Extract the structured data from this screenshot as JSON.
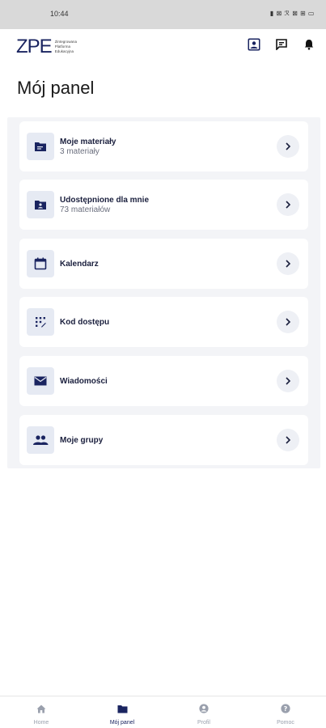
{
  "status_bar": {
    "time": "10:44",
    "indicators": "▮ ⊠ ℛ ⊠ ⊞ ▭"
  },
  "app": {
    "logo_text": "ZPE",
    "logo_tagline": [
      "Zintegrowana",
      "Platforma",
      "Edukacyjna"
    ]
  },
  "header_icons": [
    "account-circle-icon",
    "message-icon",
    "bell-icon"
  ],
  "page_title": "Mój panel",
  "cards": [
    {
      "title": "Moje materiały",
      "subtitle": "3 materiały",
      "icon": "folder-icon"
    },
    {
      "title": "Udostępnione dla mnie",
      "subtitle": "73 materiałów",
      "icon": "shared-folder-icon"
    },
    {
      "title": "Kalendarz",
      "subtitle": "",
      "icon": "calendar-icon"
    },
    {
      "title": "Kod dostępu",
      "subtitle": "",
      "icon": "keypad-icon"
    },
    {
      "title": "Wiadomości",
      "subtitle": "",
      "icon": "envelope-icon"
    },
    {
      "title": "Moje grupy",
      "subtitle": "",
      "icon": "people-icon"
    }
  ],
  "bottom_nav": [
    {
      "label": "Home",
      "icon": "home-icon",
      "active": false
    },
    {
      "label": "Mój panel",
      "icon": "folder-icon",
      "active": true
    },
    {
      "label": "Profil",
      "icon": "profile-icon",
      "active": false
    },
    {
      "label": "Pomoc",
      "icon": "help-icon",
      "active": false
    }
  ],
  "colors": {
    "primary": "#1a2460",
    "accent": "#2a58c8",
    "panel_bg": "#f3f4f7",
    "tile_bg": "#e6eaf3",
    "nav_inactive": "#9aa0ad"
  }
}
